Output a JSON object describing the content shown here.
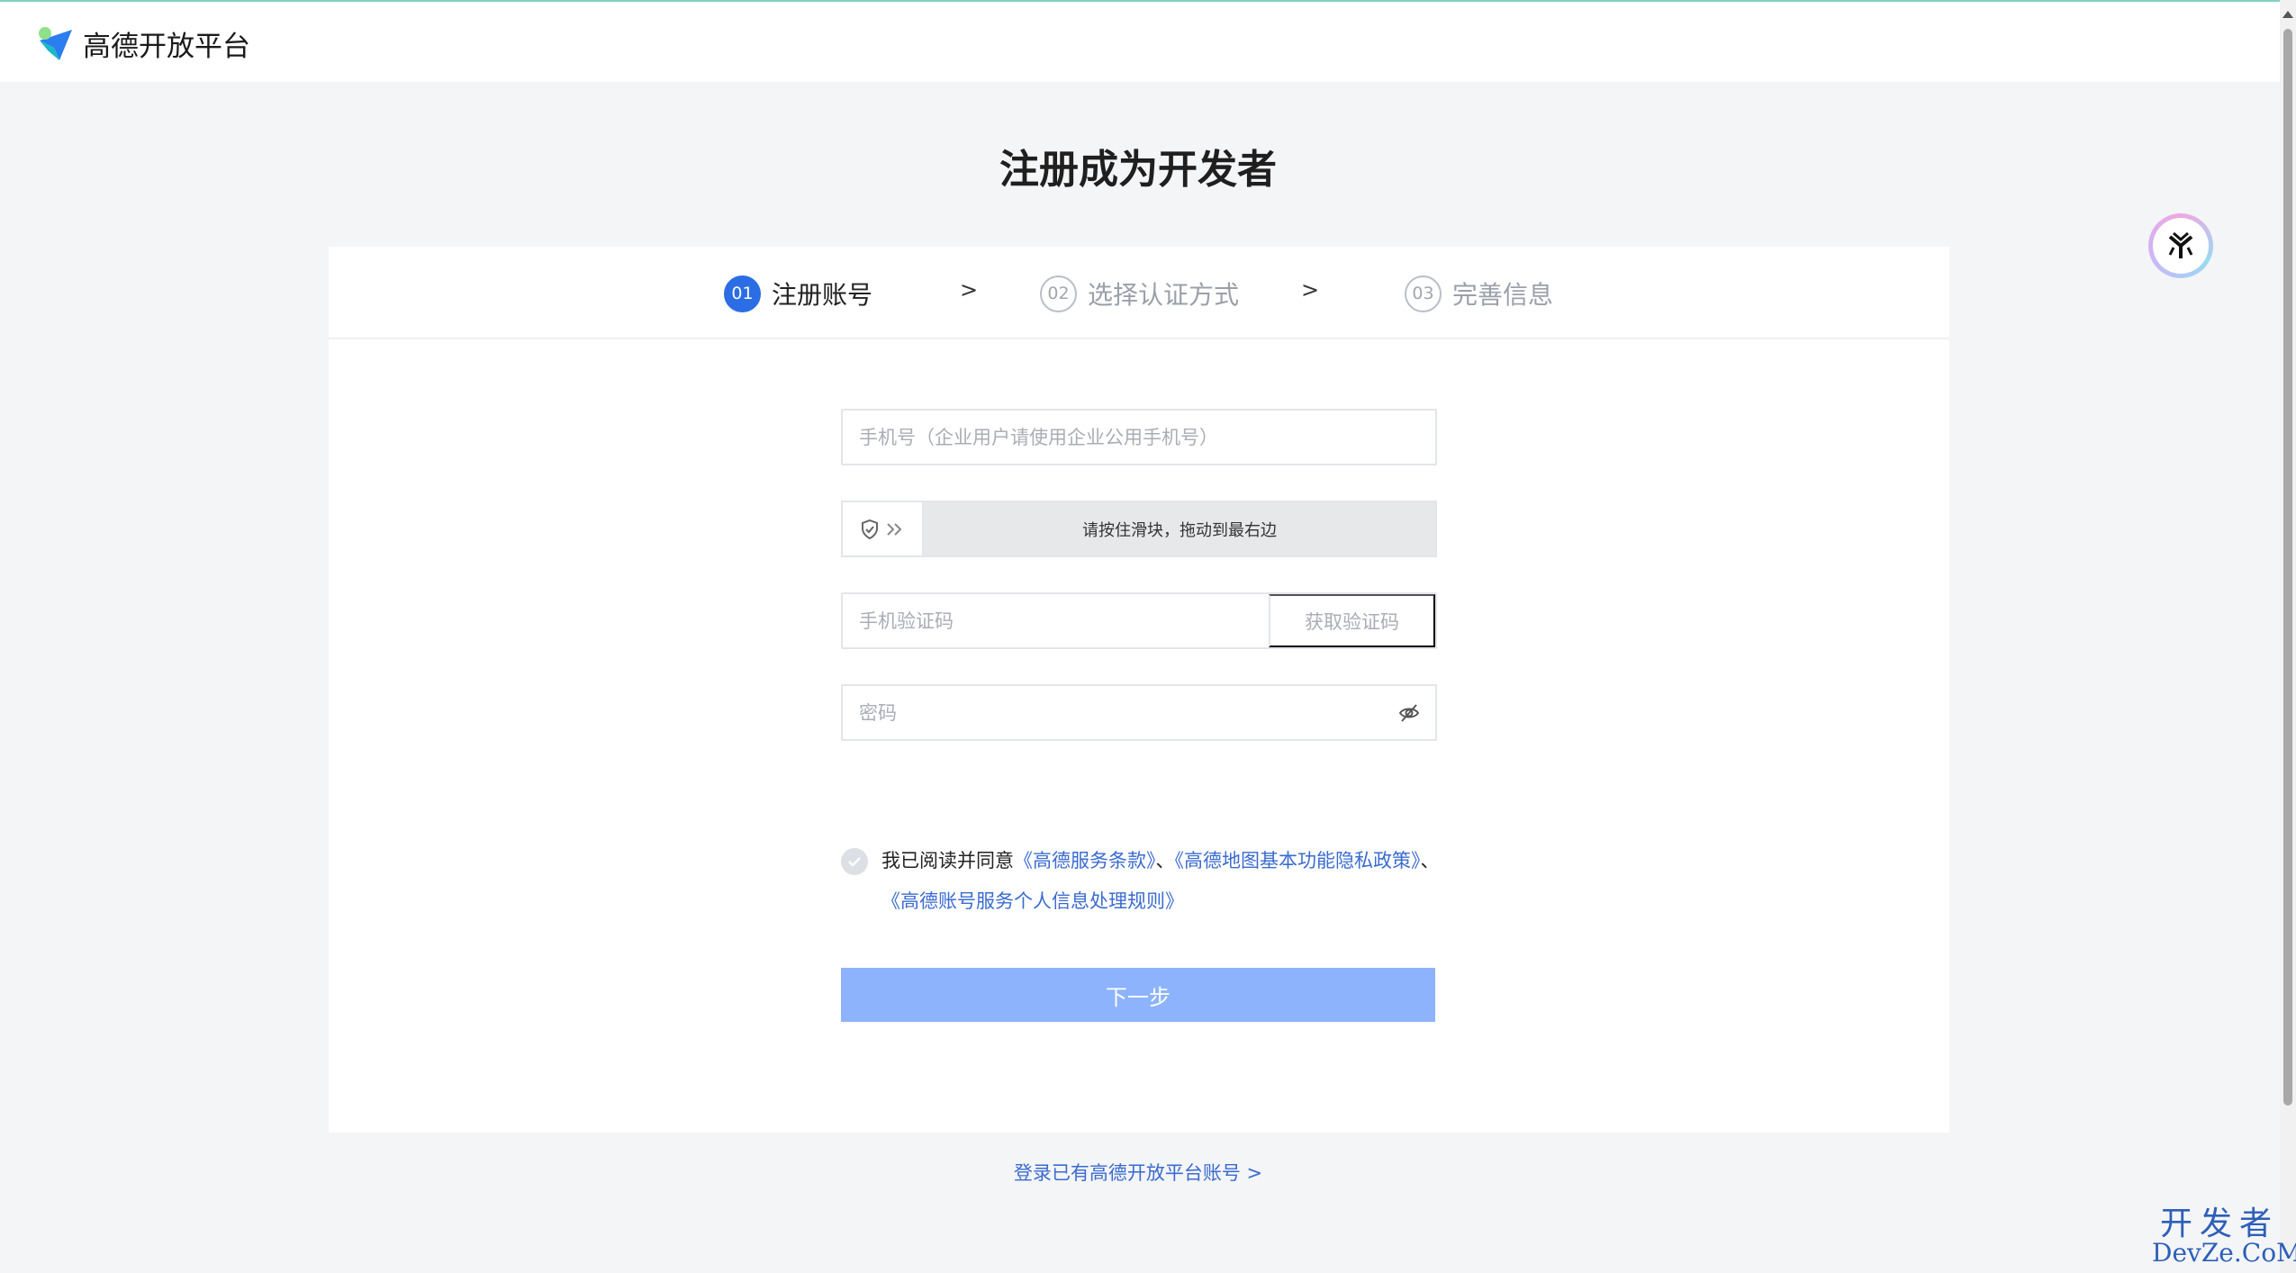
{
  "header": {
    "brand_name": "高德开放平台"
  },
  "page": {
    "title": "注册成为开发者"
  },
  "steps": [
    {
      "number": "01",
      "label": "注册账号",
      "active": true
    },
    {
      "number": "02",
      "label": "选择认证方式",
      "active": false
    },
    {
      "number": "03",
      "label": "完善信息",
      "active": false
    }
  ],
  "step_separator": ">",
  "form": {
    "phone_placeholder": "手机号（企业用户请使用企业公用手机号）",
    "slider_text": "请按住滑块，拖动到最右边",
    "sms_code_placeholder": "手机验证码",
    "get_code_label": "获取验证码",
    "password_placeholder": "密码"
  },
  "agreement": {
    "prefix": "我已阅读并同意",
    "link_terms": "《高德服务条款》",
    "sep1": "、",
    "link_privacy": "《高德地图基本功能隐私政策》",
    "sep2": "、",
    "link_account_rules": "《高德账号服务个人信息处理规则》"
  },
  "next_button_label": "下一步",
  "login_link": "登录已有高德开放平台账号 >",
  "watermark": {
    "top": "开发者",
    "bottom": "DevZe.CoM"
  },
  "colors": {
    "accent": "#2b6de5",
    "button_disabled": "#8cb3fb",
    "link": "#3a6bd0"
  }
}
